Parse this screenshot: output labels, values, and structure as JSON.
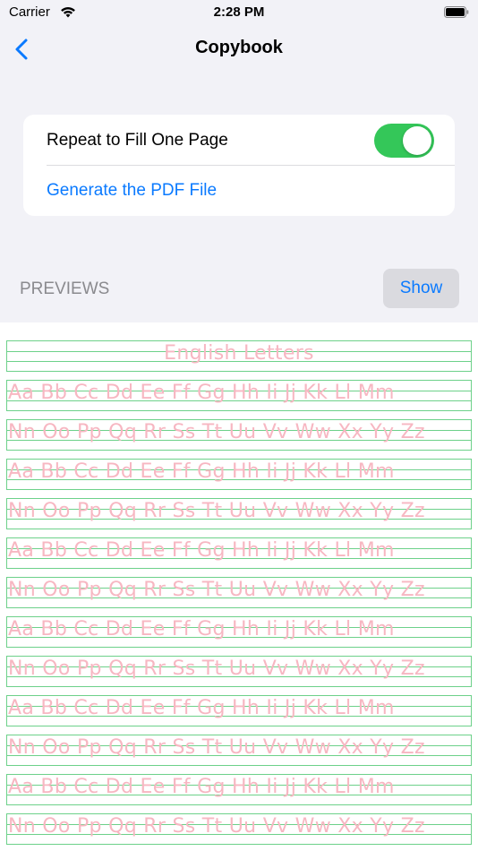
{
  "status": {
    "carrier": "Carrier",
    "time": "2:28 PM"
  },
  "nav": {
    "title": "Copybook"
  },
  "settings": {
    "repeat_label": "Repeat to Fill One Page",
    "repeat_on": true,
    "generate_label": "Generate the PDF File"
  },
  "previews": {
    "header": "PREVIEWS",
    "show_label": "Show"
  },
  "preview_lines": [
    "English Letters",
    "Aa Bb Cc Dd Ee Ff Gg Hh Ii Jj Kk Ll Mm",
    "Nn Oo Pp Qq Rr Ss Tt Uu Vv Ww Xx Yy Zz",
    "Aa Bb Cc Dd Ee Ff Gg Hh Ii Jj Kk Ll Mm",
    "Nn Oo Pp Qq Rr Ss Tt Uu Vv Ww Xx Yy Zz",
    "Aa Bb Cc Dd Ee Ff Gg Hh Ii Jj Kk Ll Mm",
    "Nn Oo Pp Qq Rr Ss Tt Uu Vv Ww Xx Yy Zz",
    "Aa Bb Cc Dd Ee Ff Gg Hh Ii Jj Kk Ll Mm",
    "Nn Oo Pp Qq Rr Ss Tt Uu Vv Ww Xx Yy Zz",
    "Aa Bb Cc Dd Ee Ff Gg Hh Ii Jj Kk Ll Mm",
    "Nn Oo Pp Qq Rr Ss Tt Uu Vv Ww Xx Yy Zz",
    "Aa Bb Cc Dd Ee Ff Gg Hh Ii Jj Kk Ll Mm",
    "Nn Oo Pp Qq Rr Ss Tt Uu Vv Ww Xx Yy Zz"
  ],
  "colors": {
    "accent": "#0a7aff",
    "toggle_on": "#34c759",
    "guide_line": "#6dd18a",
    "trace_text": "#f7b7c2"
  }
}
